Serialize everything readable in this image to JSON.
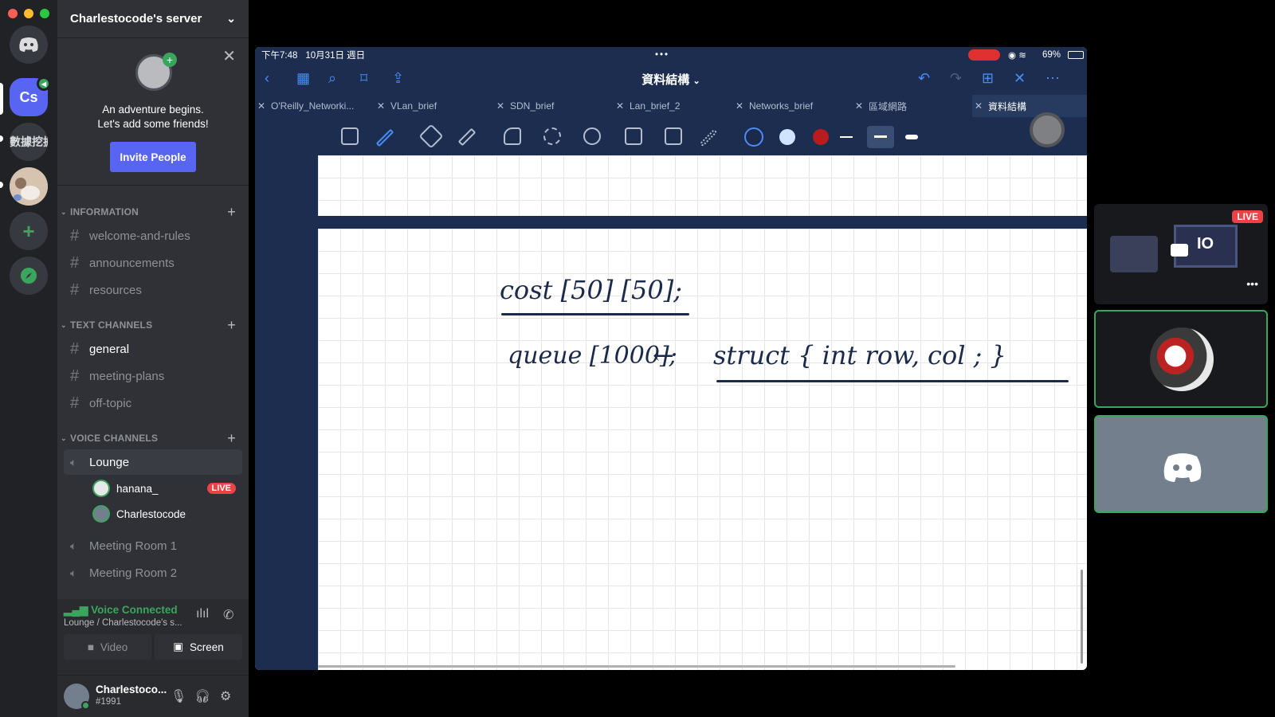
{
  "server": {
    "name": "Charlestocode's server",
    "rail_initials": "Cs",
    "rail_label_2": "數據挖掘"
  },
  "invite": {
    "line1": "An adventure begins.",
    "line2": "Let's add some friends!",
    "button": "Invite People"
  },
  "categories": {
    "information": "INFORMATION",
    "text": "TEXT CHANNELS",
    "voice": "VOICE CHANNELS"
  },
  "info_channels": [
    "welcome-and-rules",
    "announcements",
    "resources"
  ],
  "text_channels": [
    "general",
    "meeting-plans",
    "off-topic"
  ],
  "voice": {
    "lounge": "Lounge",
    "users": [
      {
        "name": "hanana_",
        "badge": "LIVE"
      },
      {
        "name": "Charlestocode",
        "badge": ""
      }
    ],
    "room1": "Meeting Room 1",
    "room2": "Meeting Room 2"
  },
  "rtc": {
    "status": "Voice Connected",
    "location": "Lounge / Charlestocode's s...",
    "video": "Video",
    "screen": "Screen"
  },
  "user": {
    "name": "Charlestoco...",
    "tag": "#1991"
  },
  "ipad": {
    "time": "下午7:48",
    "date": "10月31日 週日",
    "battery": "69%",
    "doc_title": "資料結構",
    "tabs": [
      "O'Reilly_Networki...",
      "VLan_brief",
      "SDN_brief",
      "Lan_brief_2",
      "Networks_brief",
      "區域網路",
      "資料結構"
    ]
  },
  "handwriting": {
    "line1": "cost [50] [50];",
    "line2a": "queue [1000];",
    "arrow": "←",
    "line2b": "struct {  int  row, col ; }"
  },
  "tiles": {
    "live": "LIVE",
    "cam_label": "IO"
  },
  "colors": {
    "blurple": "#5865f2",
    "green": "#3ba55d",
    "red": "#ed4245",
    "ipad_bar": "#1c2d4f"
  }
}
